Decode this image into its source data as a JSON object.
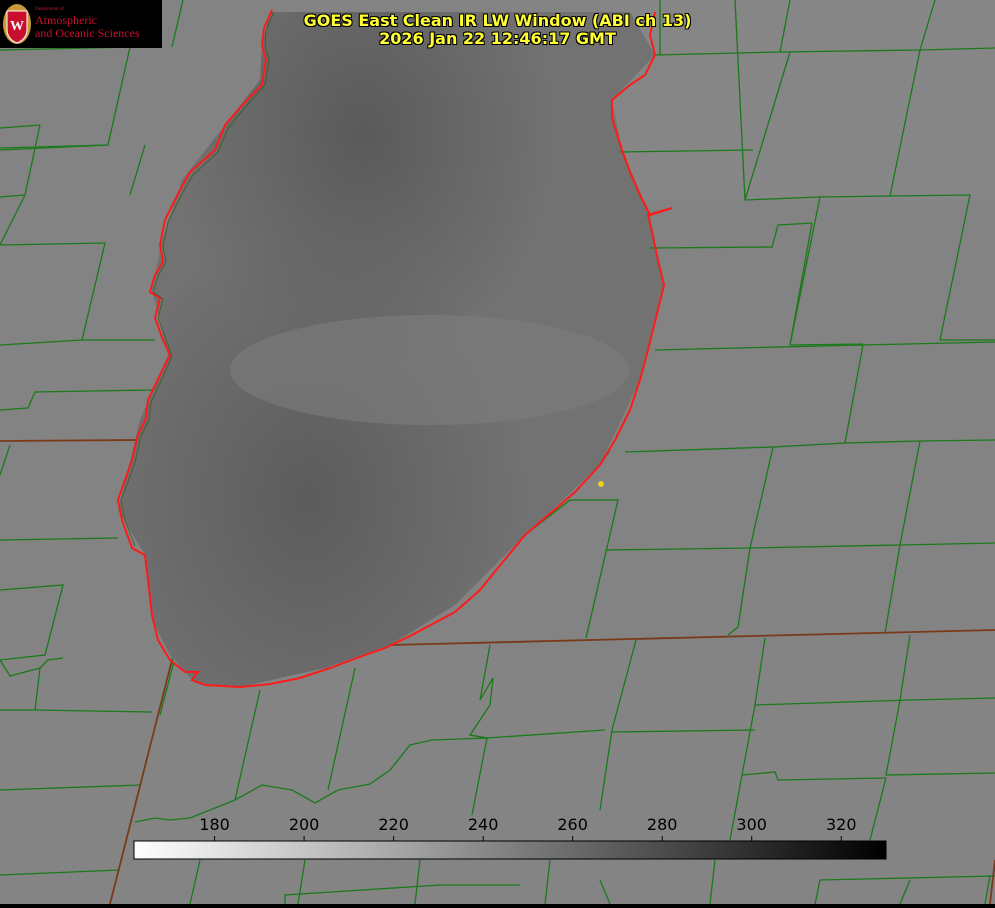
{
  "logo": {
    "line1": "Department of",
    "line2": "Atmospheric",
    "line3": "and Oceanic Sciences",
    "color": "#c8102e"
  },
  "title": {
    "line1": "GOES East Clean IR LW Window (ABI ch 13)",
    "line2": "2026 Jan 22 12:46:17 GMT",
    "color": "#ffff33"
  },
  "colorbar": {
    "ticks": [
      "180",
      "200",
      "220",
      "240",
      "260",
      "280",
      "300",
      "320"
    ],
    "tick_values": [
      180,
      200,
      220,
      240,
      260,
      280,
      300,
      320
    ],
    "range": [
      162,
      330
    ],
    "gradient": "white-to-black"
  },
  "map": {
    "feature": "lake",
    "county_line_color": "#1a7a1a",
    "shoreline_color": "#ff1a1a",
    "marker_color": "#e6d21a"
  }
}
